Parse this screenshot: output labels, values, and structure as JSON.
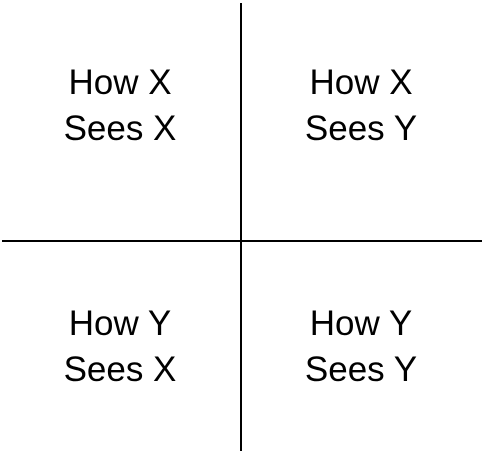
{
  "quadrants": {
    "top_left": {
      "line1": "How X",
      "line2": "Sees X"
    },
    "top_right": {
      "line1": "How X",
      "line2": "Sees Y"
    },
    "bottom_left": {
      "line1": "How Y",
      "line2": "Sees X"
    },
    "bottom_right": {
      "line1": "How Y",
      "line2": "Sees Y"
    }
  }
}
